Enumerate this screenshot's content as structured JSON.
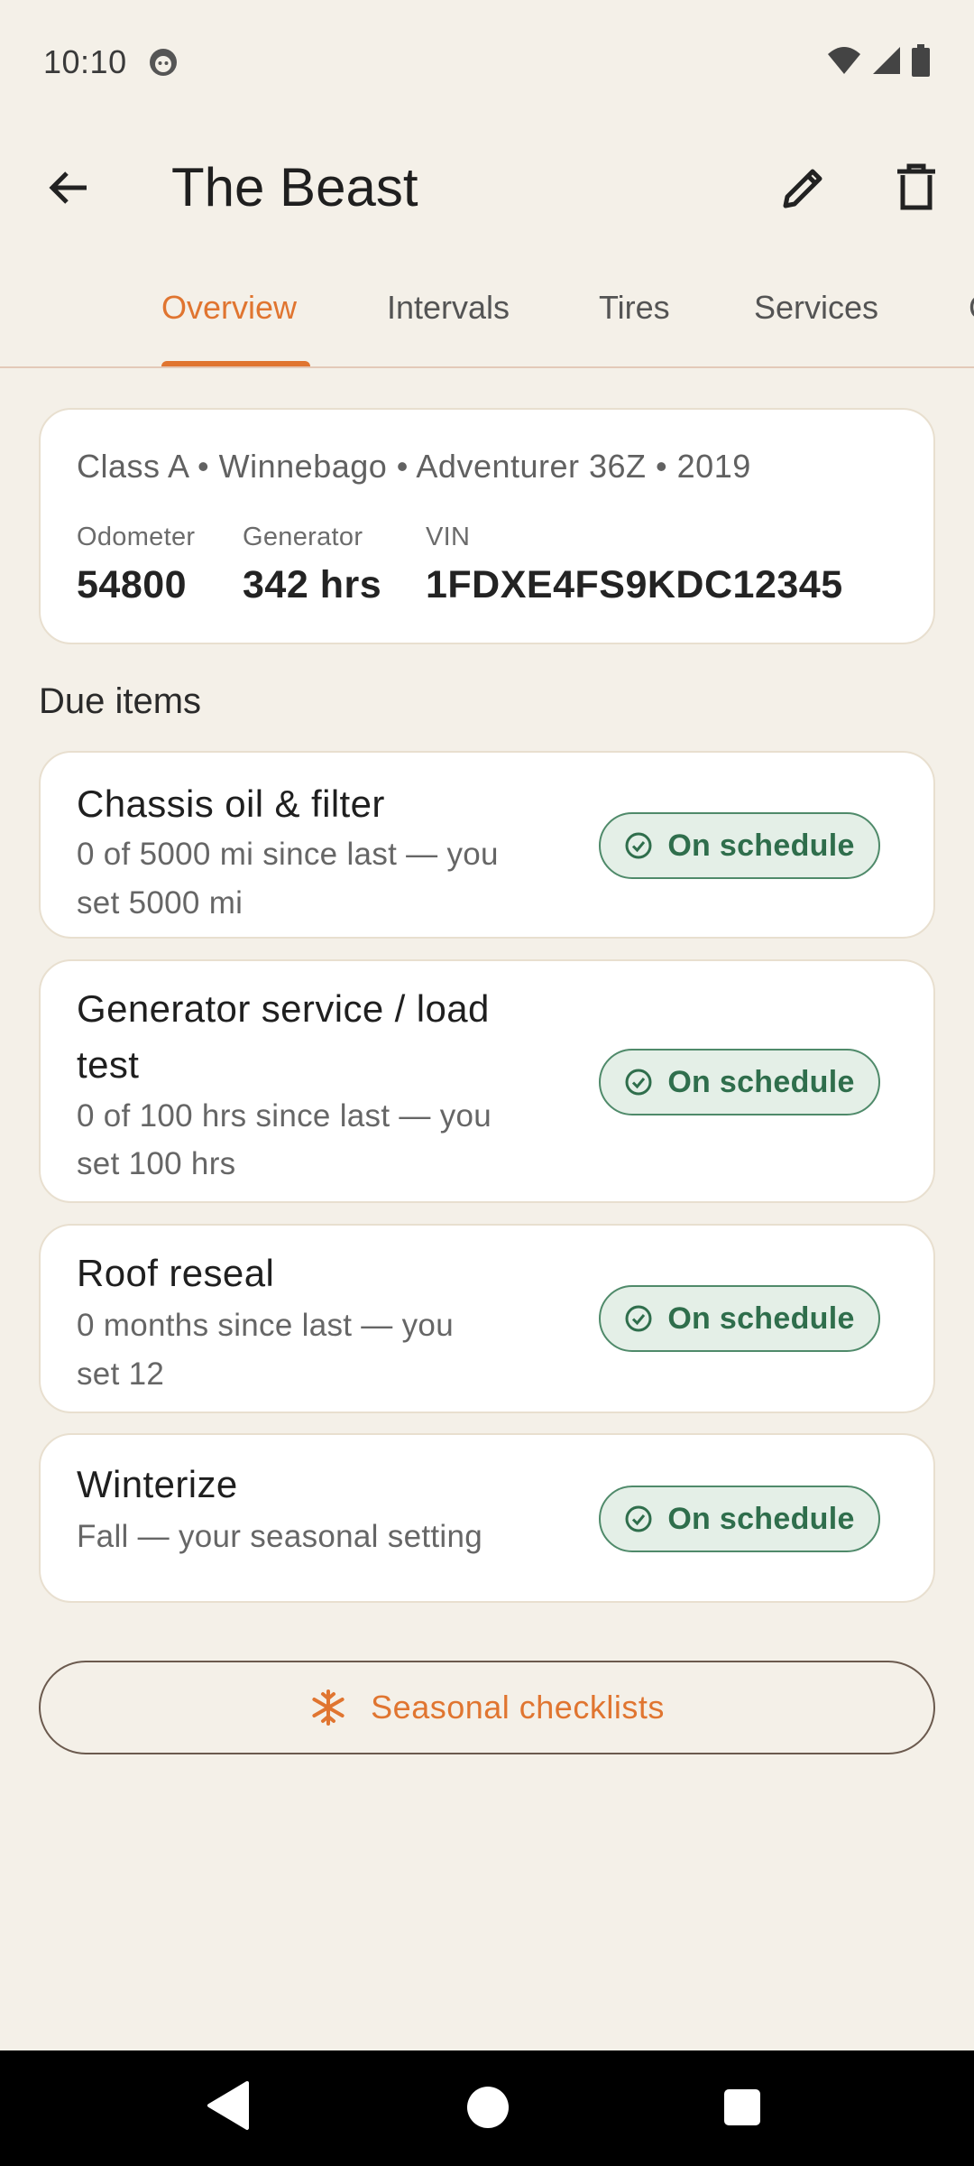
{
  "status_bar": {
    "time": "10:10"
  },
  "app_bar": {
    "title": "The Beast"
  },
  "tabs": [
    {
      "label": "Overview",
      "active": true
    },
    {
      "label": "Intervals",
      "active": false
    },
    {
      "label": "Tires",
      "active": false
    },
    {
      "label": "Services",
      "active": false
    },
    {
      "label": "C",
      "active": false
    }
  ],
  "vehicle": {
    "summary": "Class A • Winnebago • Adventurer 36Z • 2019",
    "stats": [
      {
        "label": "Odometer",
        "value": "54800"
      },
      {
        "label": "Generator",
        "value": "342 hrs"
      },
      {
        "label": "VIN",
        "value": "1FDXE4FS9KDC12345"
      }
    ]
  },
  "due_section": {
    "heading": "Due items"
  },
  "due_items": [
    {
      "title_lines": [
        "Chassis oil & filter"
      ],
      "detail_lines": [
        "0 of 5000 mi since last — you",
        "set 5000 mi"
      ],
      "status": "On schedule"
    },
    {
      "title_lines": [
        "Generator service / load",
        "test"
      ],
      "detail_lines": [
        "0 of 100 hrs since last — you",
        "set 100 hrs"
      ],
      "status": "On schedule"
    },
    {
      "title_lines": [
        "Roof reseal"
      ],
      "detail_lines": [
        "0 months since last — you",
        "set 12"
      ],
      "status": "On schedule"
    },
    {
      "title_lines": [
        "Winterize"
      ],
      "detail_lines": [
        "Fall — your seasonal setting"
      ],
      "status": "On schedule"
    }
  ],
  "seasonal_button": {
    "label": "Seasonal checklists",
    "icon": "snowflake-icon"
  },
  "colors": {
    "accent": "#e07530",
    "background": "#f4f0e8",
    "status_green": "#2f6e4c",
    "status_green_bg": "#e4efe7"
  }
}
